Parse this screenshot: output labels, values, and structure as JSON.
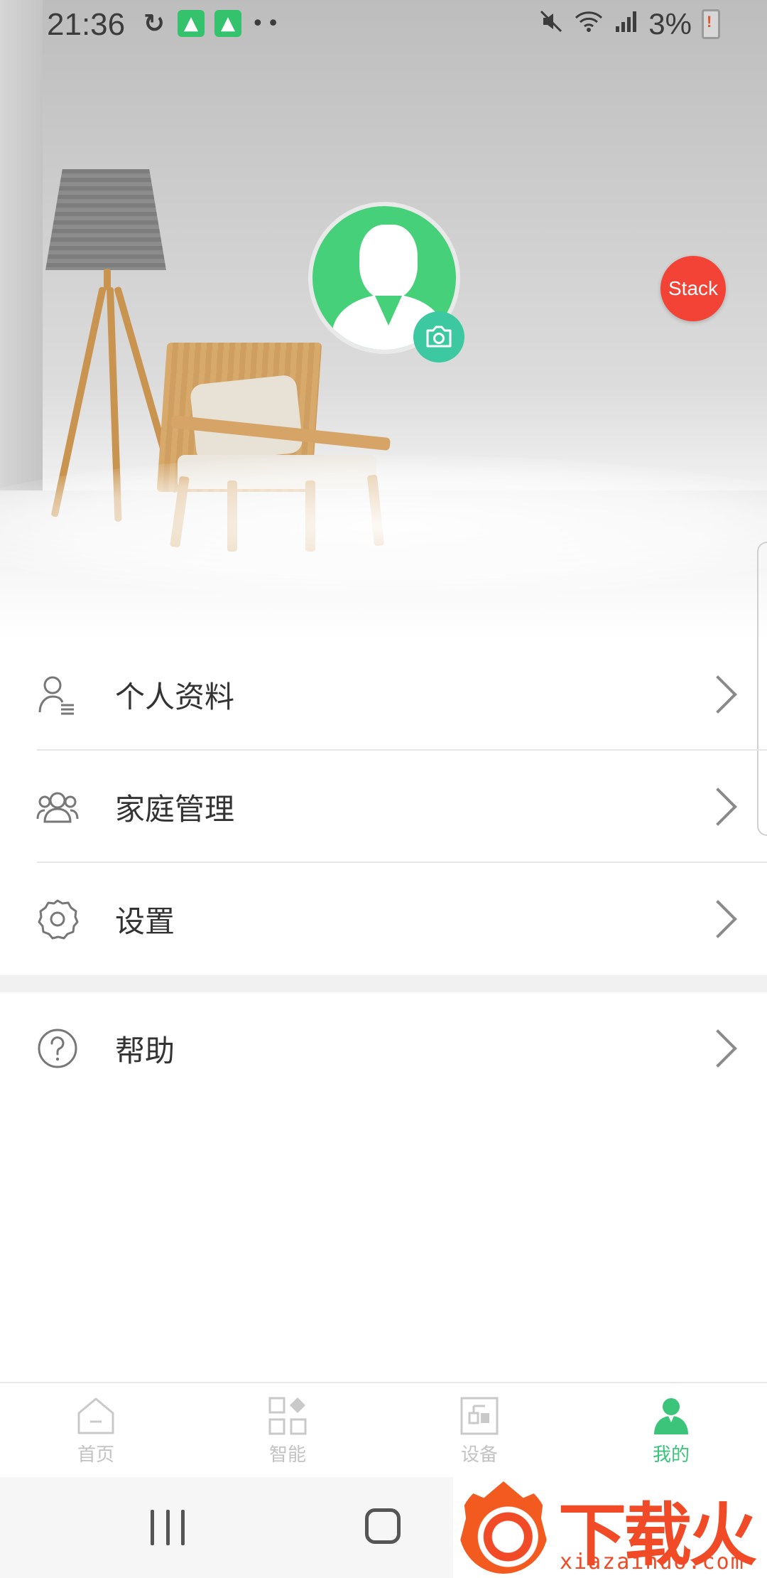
{
  "status_bar": {
    "time": "21:36",
    "battery": "3%",
    "icons_left": [
      "sync-icon",
      "app-notification-icon",
      "app-notification-icon",
      "more-dots-icon"
    ],
    "icons_right": [
      "mute-icon",
      "wifi-icon",
      "signal-icon",
      "battery-low-icon"
    ]
  },
  "profile": {
    "avatar": "default-user-avatar",
    "camera_icon": "camera-icon",
    "floating_button": "Stack"
  },
  "menu": {
    "items": [
      {
        "label": "个人资料",
        "icon": "user-profile-icon"
      },
      {
        "label": "家庭管理",
        "icon": "family-group-icon"
      },
      {
        "label": "设置",
        "icon": "gear-icon"
      },
      {
        "label": "帮助",
        "icon": "help-icon"
      }
    ]
  },
  "tabbar": {
    "tabs": [
      {
        "label": "首页",
        "icon": "home-icon",
        "active": false
      },
      {
        "label": "智能",
        "icon": "smart-grid-icon",
        "active": false
      },
      {
        "label": "设备",
        "icon": "device-icon",
        "active": false
      },
      {
        "label": "我的",
        "icon": "person-icon",
        "active": true
      }
    ]
  },
  "watermark": {
    "title": "下载火",
    "subtitle": "xiazaihuo.com"
  },
  "colors": {
    "accent_green": "#3cc47a",
    "avatar_green": "#47d07a",
    "stack_red": "#f24336",
    "watermark_orange": "#f04a26"
  }
}
